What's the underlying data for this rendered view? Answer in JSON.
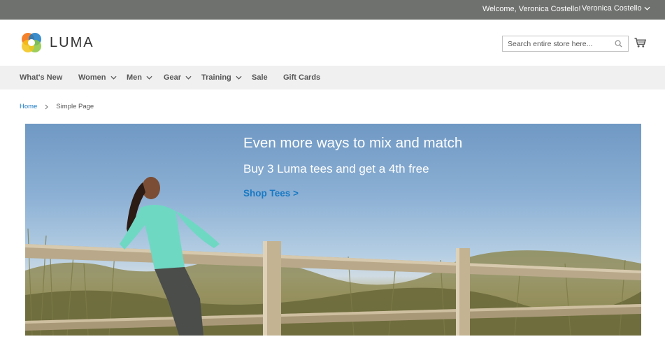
{
  "header": {
    "welcome_text": "Welcome, Veronica Costello!",
    "account_name": "Veronica Costello",
    "logo_text": "LUMA",
    "search_placeholder": "Search entire store here...",
    "icons": [
      "chevron-down-icon",
      "search-icon",
      "cart-icon",
      "luma-logo-icon"
    ]
  },
  "nav": {
    "items": [
      {
        "label": "What's New",
        "has_dropdown": false
      },
      {
        "label": "Women",
        "has_dropdown": true
      },
      {
        "label": "Men",
        "has_dropdown": true
      },
      {
        "label": "Gear",
        "has_dropdown": true
      },
      {
        "label": "Training",
        "has_dropdown": true
      },
      {
        "label": "Sale",
        "has_dropdown": false
      },
      {
        "label": "Gift Cards",
        "has_dropdown": false
      }
    ]
  },
  "breadcrumb": {
    "home": "Home",
    "current": "Simple Page"
  },
  "hero": {
    "title": "Even more ways to mix and match",
    "subtitle": "Buy 3 Luma tees and get a 4th free",
    "link_text": "Shop Tees >"
  },
  "colors": {
    "top_bar": "#6e716e",
    "nav_bar": "#f0f0f0",
    "link_blue": "#1979c3"
  }
}
